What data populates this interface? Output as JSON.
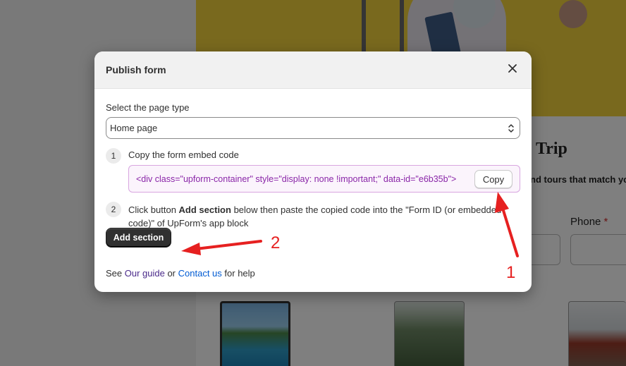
{
  "background": {
    "heading": "Trip",
    "subheading": "nd tours that match yo",
    "phone_label": "Phone",
    "required_mark": "*"
  },
  "modal": {
    "title": "Publish form",
    "close_icon": "close-icon",
    "select_label": "Select the page type",
    "select_value": "Home page",
    "steps": [
      {
        "number": "1",
        "text": "Copy the form embed code"
      },
      {
        "number": "2",
        "text_before": "Click button ",
        "text_bold": "Add section",
        "text_after": " below then paste the copied code into the \"Form ID (or embedded code)\" of UpForm's app block"
      }
    ],
    "embed_code": "<div class=\"upform-container\" style=\"display: none !important;\" data-id=\"e6b35b\">",
    "copy_label": "Copy",
    "add_section_label": "Add section",
    "help": {
      "prefix": "See ",
      "guide_link": "Our guide",
      "middle": " or ",
      "contact_link": "Contact us",
      "suffix": " for help"
    }
  },
  "annotations": {
    "label_1": "1",
    "label_2": "2",
    "color": "#e62020"
  },
  "colors": {
    "hero_yellow": "#f2d23c",
    "code_text": "#8a26a8",
    "link": "#005bd3",
    "primary_button": "#303030"
  }
}
